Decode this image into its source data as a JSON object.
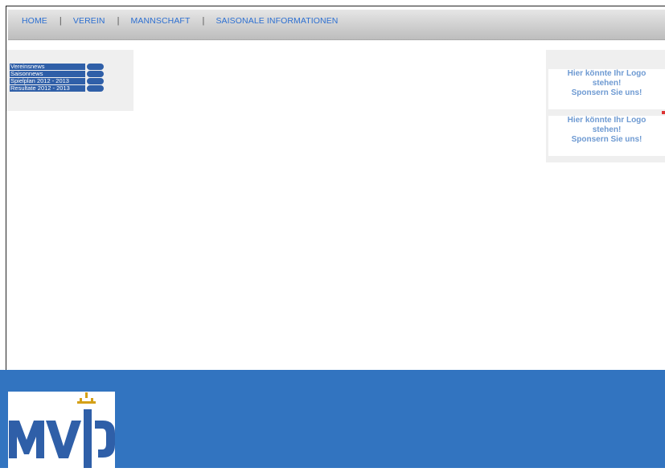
{
  "nav": {
    "items": [
      {
        "label": "HOME"
      },
      {
        "label": "VEREIN"
      },
      {
        "label": "MANNSCHAFT"
      },
      {
        "label": "SAISONALE INFORMATIONEN"
      }
    ],
    "separator": "|"
  },
  "menu": {
    "items": [
      {
        "label": "Vereinsnews"
      },
      {
        "label": "Saisonnews"
      },
      {
        "label": "Spielplan 2012 - 2013"
      },
      {
        "label": "Resultate 2012 - 2013"
      }
    ]
  },
  "sponsors": [
    {
      "line1": "Hier könnte Ihr Logo",
      "line2": "stehen!",
      "line3": "Sponsern Sie uns!"
    },
    {
      "line1": "Hier könnte Ihr Logo",
      "line2": "stehen!",
      "line3": "Sponsern Sie uns!"
    }
  ],
  "footer": {
    "logo_text": "MVP",
    "background_color": "#3274c0",
    "logo_color": "#2f5fa8",
    "crown_color": "#d4a017"
  }
}
